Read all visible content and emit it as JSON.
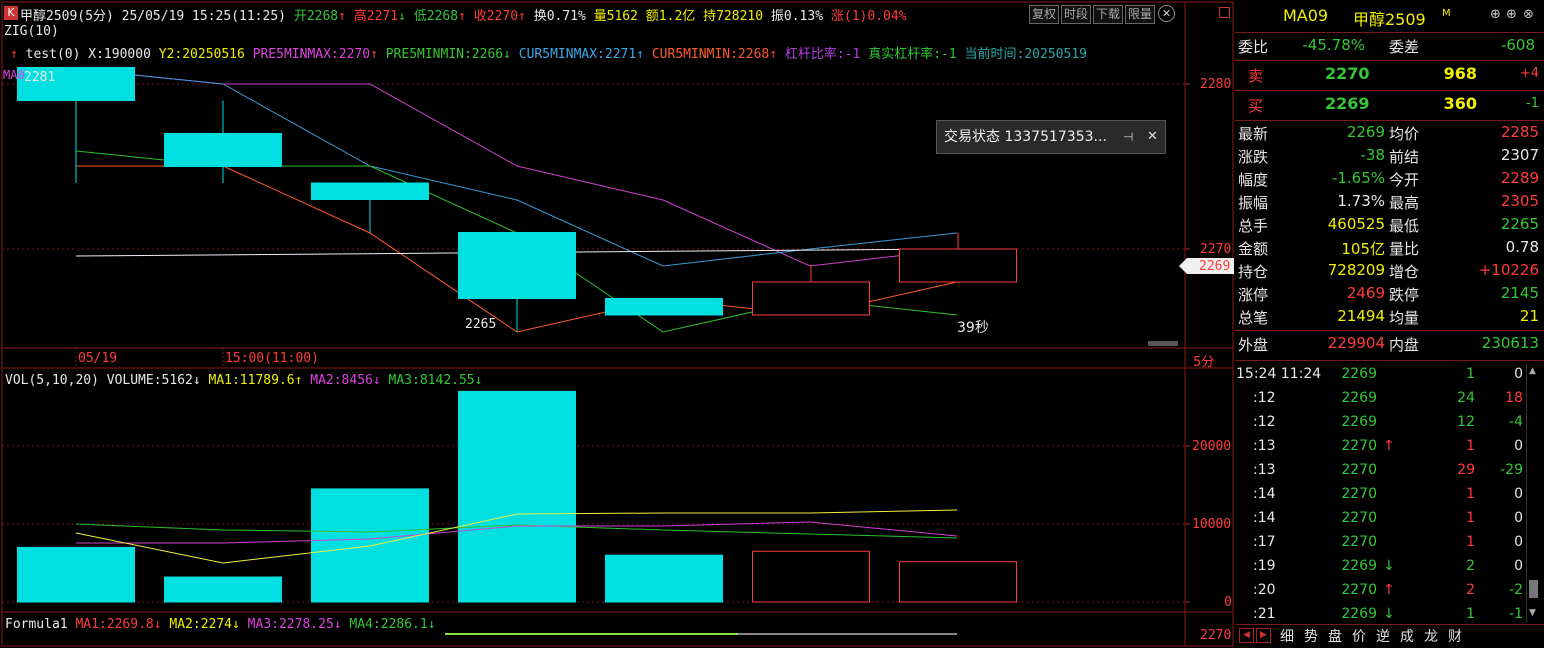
{
  "header": {
    "k_badge": "K",
    "title": "甲醇2509(5分) 25/05/19 15:25(11:25)",
    "open": "开2268",
    "high": "高2271",
    "low": "低2268",
    "close": "收2270",
    "turnover": "换0.71%",
    "volume": "量5162",
    "amount": "额1.2亿",
    "hold": "持728210",
    "swing": "振0.13%",
    "change": "涨(1)0.04%",
    "buttons": [
      "复权",
      "时段",
      "下载",
      "限量"
    ]
  },
  "indicators": {
    "zig": "ZIG(10)",
    "test": "test(0)",
    "x": "X:190000",
    "y2": "Y2:20250516",
    "pre5max": "PRE5MINMAX:2270",
    "pre5min": "PRE5MINMIN:2266",
    "cur5max": "CUR5MINMAX:2271",
    "cur5min": "CUR5MINMIN:2268",
    "lever": "杠杆比率:-1",
    "real_lever": "真实杠杆率:-1",
    "cur_time": "当前时间:20250519",
    "ma_label": "MA0",
    "price_label_2281": "2281",
    "low_label": "2265",
    "timer": "39秒",
    "axis_2280": "2280",
    "axis_2270": "2270",
    "current_price_tag": "2269",
    "xlabel_1": "05/19",
    "xlabel_2": "15:00(11:00)",
    "period": "5分"
  },
  "volume_panel": {
    "vol_label": "VOL(5,10,20)",
    "volume": "VOLUME:5162",
    "ma1": "MA1:11789.6",
    "ma2": "MA2:8456",
    "ma3": "MA3:8142.55",
    "axis_20000": "20000",
    "axis_10000": "10000",
    "axis_0": "0"
  },
  "formula_panel": {
    "label": "Formula1",
    "ma1": "MA1:2269.8",
    "ma2": "MA2:2274",
    "ma3": "MA3:2278.25",
    "ma4": "MA4:2286.1",
    "axis": "2270"
  },
  "popup": {
    "text": "交易状态 1337517353...",
    "pin": "⊣",
    "close": "✕"
  },
  "chart_data": {
    "type": "candlestick",
    "candles": [
      {
        "open": 2279,
        "close": 2281,
        "high": 2281,
        "low": 2274
      },
      {
        "open": 2275,
        "close": 2277,
        "high": 2279,
        "low": 2274
      },
      {
        "open": 2274,
        "close": 2273,
        "high": 2274,
        "low": 2271
      },
      {
        "open": 2271,
        "close": 2267,
        "high": 2271,
        "low": 2265
      },
      {
        "open": 2266,
        "close": 2267,
        "high": 2266,
        "low": 2266
      },
      {
        "open": 2266,
        "close": 2268,
        "high": 2269,
        "low": 2266
      },
      {
        "open": 2270,
        "close": 2268,
        "high": 2271,
        "low": 2268
      }
    ],
    "volumes": [
      7000,
      3200,
      14500,
      27000,
      6000,
      6500,
      5162
    ],
    "ylim_price": [
      2263,
      2283
    ],
    "ylim_volume": [
      0,
      28000
    ]
  },
  "right_panel": {
    "symbol_code": "MA09",
    "symbol_name": "甲醇2509",
    "symbol_sup": "M",
    "webi_label": "委比",
    "webi_value": "-45.78%",
    "weicha_label": "委差",
    "weicha_value": "-608",
    "sell_label": "卖",
    "sell_price": "2270",
    "sell_vol": "968",
    "sell_chg": "+4",
    "buy_label": "买",
    "buy_price": "2269",
    "buy_vol": "360",
    "buy_chg": "-1",
    "stats": [
      {
        "l1": "最新",
        "v1": "2269",
        "c1": "grn",
        "l2": "均价",
        "v2": "2285",
        "c2": "red"
      },
      {
        "l1": "涨跌",
        "v1": "-38",
        "c1": "grn",
        "l2": "前结",
        "v2": "2307",
        "c2": "wht"
      },
      {
        "l1": "幅度",
        "v1": "-1.65%",
        "c1": "grn",
        "l2": "今开",
        "v2": "2289",
        "c2": "red"
      },
      {
        "l1": "振幅",
        "v1": "1.73%",
        "c1": "wht",
        "l2": "最高",
        "v2": "2305",
        "c2": "red"
      },
      {
        "l1": "总手",
        "v1": "460525",
        "c1": "yel",
        "l2": "最低",
        "v2": "2265",
        "c2": "grn"
      },
      {
        "l1": "金额",
        "v1": "105亿",
        "c1": "yel",
        "l2": "量比",
        "v2": "0.78",
        "c2": "wht"
      },
      {
        "l1": "持仓",
        "v1": "728209",
        "c1": "yel",
        "l2": "增仓",
        "v2": "+10226",
        "c2": "red"
      },
      {
        "l1": "涨停",
        "v1": "2469",
        "c1": "red",
        "l2": "跌停",
        "v2": "2145",
        "c2": "grn"
      },
      {
        "l1": "总笔",
        "v1": "21494",
        "c1": "yel",
        "l2": "均量",
        "v2": "21",
        "c2": "yel"
      }
    ],
    "outer_label": "外盘",
    "outer_value": "229904",
    "inner_label": "内盘",
    "inner_value": "230613",
    "ticks": [
      {
        "t": "15:24 11:24",
        "p": "2269",
        "pc": "grn",
        "arr": "",
        "ac": "",
        "v": "1",
        "vc": "grn",
        "d": "0",
        "dc": "wht"
      },
      {
        "t": ":12",
        "p": "2269",
        "pc": "grn",
        "arr": "",
        "ac": "",
        "v": "24",
        "vc": "grn",
        "d": "18",
        "dc": "red"
      },
      {
        "t": ":12",
        "p": "2269",
        "pc": "grn",
        "arr": "",
        "ac": "",
        "v": "12",
        "vc": "grn",
        "d": "-4",
        "dc": "grn"
      },
      {
        "t": ":13",
        "p": "2270",
        "pc": "grn",
        "arr": "↑",
        "ac": "red",
        "v": "1",
        "vc": "red",
        "d": "0",
        "dc": "wht"
      },
      {
        "t": ":13",
        "p": "2270",
        "pc": "grn",
        "arr": "",
        "ac": "",
        "v": "29",
        "vc": "red",
        "d": "-29",
        "dc": "grn"
      },
      {
        "t": ":14",
        "p": "2270",
        "pc": "grn",
        "arr": "",
        "ac": "",
        "v": "1",
        "vc": "red",
        "d": "0",
        "dc": "wht"
      },
      {
        "t": ":14",
        "p": "2270",
        "pc": "grn",
        "arr": "",
        "ac": "",
        "v": "1",
        "vc": "red",
        "d": "0",
        "dc": "wht"
      },
      {
        "t": ":17",
        "p": "2270",
        "pc": "grn",
        "arr": "",
        "ac": "",
        "v": "1",
        "vc": "red",
        "d": "0",
        "dc": "wht"
      },
      {
        "t": ":19",
        "p": "2269",
        "pc": "grn",
        "arr": "↓",
        "ac": "grn",
        "v": "2",
        "vc": "grn",
        "d": "0",
        "dc": "wht"
      },
      {
        "t": ":20",
        "p": "2270",
        "pc": "grn",
        "arr": "↑",
        "ac": "red",
        "v": "2",
        "vc": "red",
        "d": "-2",
        "dc": "grn"
      },
      {
        "t": ":21",
        "p": "2269",
        "pc": "grn",
        "arr": "↓",
        "ac": "grn",
        "v": "1",
        "vc": "grn",
        "d": "-1",
        "dc": "grn"
      }
    ],
    "tabs": [
      "细",
      "势",
      "盘",
      "价",
      "逆",
      "成",
      "龙",
      "财"
    ]
  }
}
